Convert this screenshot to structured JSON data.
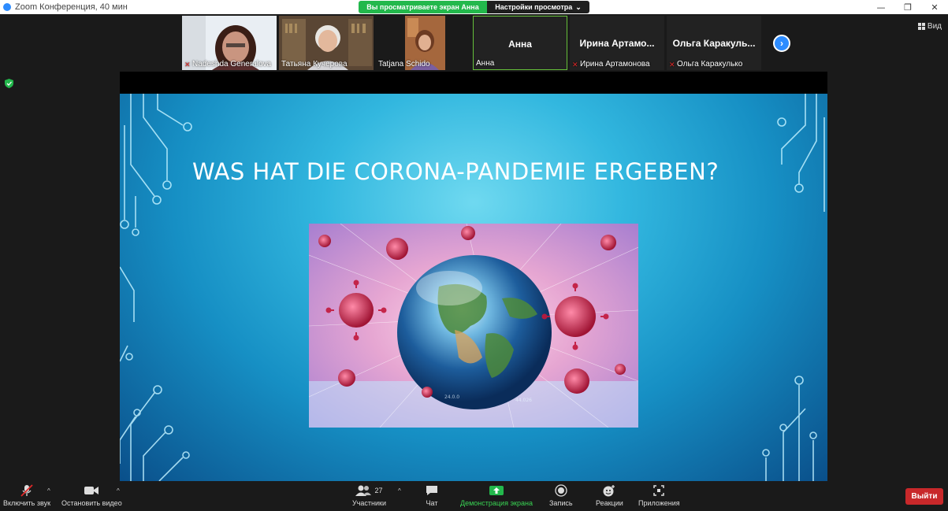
{
  "window": {
    "title": "Zoom Конференция, 40 мин",
    "controls": [
      "—",
      "❐",
      "✕"
    ]
  },
  "share_banner": {
    "viewing": "Вы просматриваете экран Анна",
    "view_options": "Настройки просмотра",
    "caret": "⌄"
  },
  "gallery": {
    "tiles": [
      {
        "name": "Nadeshda Generalova",
        "muted": true
      },
      {
        "name": "Татьяна Кучерова",
        "muted": false
      },
      {
        "name": "Tatjana Schido",
        "muted": false
      },
      {
        "big": "Анна",
        "name": "Анна",
        "muted": false
      },
      {
        "big": "Ирина  Артамо...",
        "name": "Ирина Артамонова",
        "muted": true
      },
      {
        "big": "Ольга  Каракуль...",
        "name": "Ольга Каракулько",
        "muted": true
      }
    ],
    "next_arrow": "›"
  },
  "view_button": {
    "label": "Вид"
  },
  "slide": {
    "title": "WAS HAT DIE CORONA-PANDEMIE ERGEBEN?"
  },
  "toolbar": {
    "audio": "Включить звук",
    "video": "Остановить видео",
    "participants": "Участники",
    "participants_count": "27",
    "chat": "Чат",
    "share": "Демонстрация экрана",
    "record": "Запись",
    "reactions": "Реакции",
    "apps": "Приложения",
    "leave": "Выйти",
    "caret": "^"
  },
  "colors": {
    "accent_blue": "#2d8cff",
    "share_green": "#23b84c",
    "leave_red": "#c8282a",
    "muted_red": "#e02828"
  }
}
